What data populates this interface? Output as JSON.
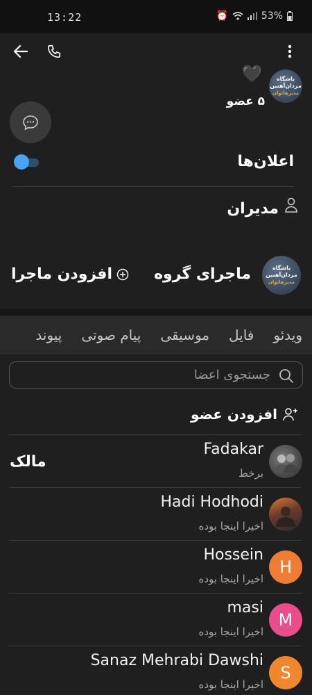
{
  "status_bar": {
    "time": "13:22",
    "battery": "53%"
  },
  "header": {
    "heart": "🖤",
    "member_count": "۵ عضو",
    "avatar_text": {
      "line1": "باشگاه",
      "line2": "مردان‌آهنین",
      "line3": "مدیرها‌توان"
    }
  },
  "settings": {
    "announcements_label": "اعلان‌ها",
    "announcements_on": true,
    "admins_label": "مدیران"
  },
  "story": {
    "title": "ماجرای گروه",
    "add_label": "افزودن ماجرا"
  },
  "tabs": [
    "ویدئو",
    "فایل",
    "موسیقی",
    "پیام صوتی",
    "پیوند"
  ],
  "members_section": {
    "search_placeholder": "جستجوی اعضا",
    "add_member_label": "افزودن عضو",
    "members": [
      {
        "name": "Fadakar",
        "status": "برخط",
        "role": "مالک",
        "avatar": "photo",
        "color": "#5a5a5a"
      },
      {
        "name": "Hadi Hodhodi",
        "status": "اخیرا اینجا بوده",
        "role": "",
        "avatar": "photo",
        "color": "#8a5a3a"
      },
      {
        "name": "Hossein",
        "status": "اخیرا اینجا بوده",
        "role": "",
        "avatar": "H",
        "color": "#ef7c34"
      },
      {
        "name": "masi",
        "status": "اخیرا اینجا بوده",
        "role": "",
        "avatar": "M",
        "color": "#e94e8a"
      },
      {
        "name": "Sanaz Mehrabi Dawshi",
        "status": "اخیرا اینجا بوده",
        "role": "",
        "avatar": "S",
        "color": "#f0872f"
      }
    ]
  },
  "colors": {
    "accent": "#4aa3f0",
    "background": "#1f1f1f"
  }
}
